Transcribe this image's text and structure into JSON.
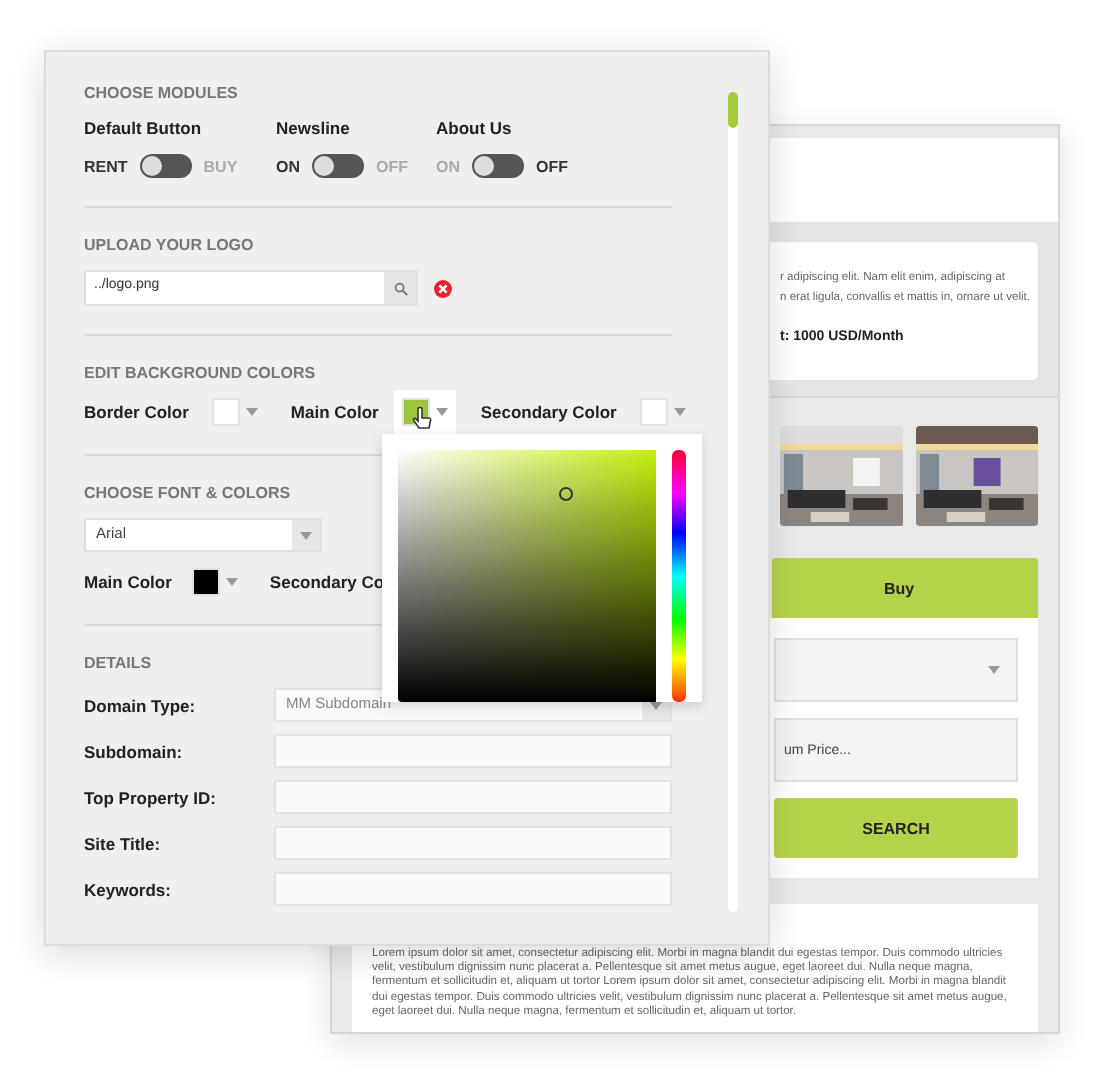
{
  "settings": {
    "modules": {
      "heading": "CHOOSE MODULES",
      "items": [
        {
          "label": "Default Button",
          "left": "RENT",
          "right": "BUY",
          "right_active": false,
          "on": false
        },
        {
          "label": "Newsline",
          "left": "ON",
          "right": "OFF",
          "right_active": false,
          "on": false
        },
        {
          "label": "About Us",
          "left": "ON",
          "right": "OFF",
          "right_active": true,
          "on": false
        }
      ]
    },
    "logo": {
      "heading": "UPLOAD YOUR LOGO",
      "value": "../logo.png"
    },
    "background_colors": {
      "heading": "EDIT BACKGROUND COLORS",
      "items": [
        {
          "label": "Border Color",
          "color": "#ffffff",
          "selected": false
        },
        {
          "label": "Main Color",
          "color": "#9cc63c",
          "selected": true
        },
        {
          "label": "Secondary Color",
          "color": "#ffffff",
          "selected": false
        }
      ]
    },
    "font": {
      "heading": "CHOOSE FONT & COLORS",
      "value": "Arial",
      "colors": [
        {
          "label": "Main Color",
          "color": "#000000"
        },
        {
          "label": "Secondary Co"
        }
      ]
    },
    "details": {
      "heading": "DETAILS",
      "fields": [
        {
          "label": "Domain Type:",
          "kind": "select",
          "value": "MM Subdomain"
        },
        {
          "label": "Subdomain:",
          "kind": "text"
        },
        {
          "label": "Top Property ID:",
          "kind": "text"
        },
        {
          "label": "Site Title:",
          "kind": "text"
        },
        {
          "label": "Keywords:",
          "kind": "text"
        }
      ]
    }
  },
  "preview": {
    "intro_lines": [
      "r adipiscing elit. Nam elit enim, adipiscing at",
      "n erat ligula, convallis et mattis in, ornare ut velit."
    ],
    "price": "t: 1000 USD/Month",
    "tabs": [
      {
        "label": "Buy",
        "selected": true
      }
    ],
    "price_placeholder": "um Price...",
    "search_button": "SEARCH",
    "footer_text": "Lorem ipsum dolor sit amet, consectetur adipiscing elit. Morbi in magna blandit dui egestas tempor. Duis commodo ultricies velit, vestibulum dignissim nunc placerat a. Pellentesque sit amet metus augue, eget laoreet dui. Nulla neque magna, fermentum et sollicitudin et, aliquam ut tortor Lorem ipsum dolor sit amet, consectetur adipiscing elit. Morbi in magna blandit dui egestas tempor. Duis commodo ultricies velit, vestibulum dignissim nunc placerat a. Pellentesque sit amet metus augue, eget laoreet dui. Nulla neque magna, fermentum et sollicitudin et, aliquam ut tortor."
  }
}
